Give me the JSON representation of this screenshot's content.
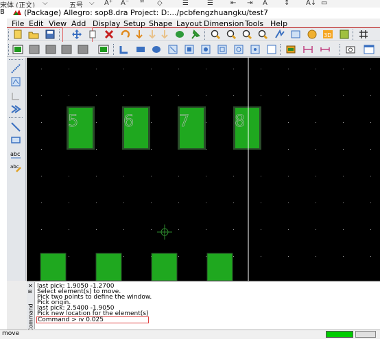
{
  "word_toolbar": {
    "font_name": "宋体 (正文)",
    "font_size": "五号",
    "left_letter": "B"
  },
  "window": {
    "title": "(Package) Allegro: sop8.dra  Project: D:.../pcbfengzhuangku/test7"
  },
  "menu": [
    {
      "label": "File"
    },
    {
      "label": "Edit"
    },
    {
      "label": "View"
    },
    {
      "label": "Add"
    },
    {
      "label": "Display"
    },
    {
      "label": "Setup"
    },
    {
      "label": "Shape"
    },
    {
      "label": "Layout"
    },
    {
      "label": "Dimension"
    },
    {
      "label": "Tools"
    },
    {
      "label": "Help"
    }
  ],
  "toolbar1_icons": [
    "new-icon",
    "open-icon",
    "save-icon",
    "move-icon",
    "copy-icon",
    "delete-icon",
    "undo-icon",
    "fix-icon",
    "unfix-icon",
    "add-connect-icon",
    "shape-icon",
    "pin-icon",
    "zoom-icon",
    "zoom-in-icon",
    "zoom-out-icon",
    "zoom-points-icon",
    "zoom-fit-icon",
    "zoom-prev-icon",
    "redraw-icon",
    "3d-view-icon",
    "grid-icon"
  ],
  "toolbar2_icons": [
    "layer-icon",
    "layer2-icon",
    "layer3-icon",
    "layer4-icon",
    "layer5-icon",
    "rect-icon",
    "roundrect-icon",
    "circle-icon",
    "pad-rect-icon",
    "pad-square-icon",
    "pad-round-icon",
    "pad-oval-icon",
    "pad-shape-icon",
    "pad-other-icon",
    "measure-icon",
    "dimension-icon",
    "dimension2-icon",
    "camera-icon",
    "window-icon"
  ],
  "left_icons": [
    "ruler-icon",
    "text-icon",
    "pin-edit-icon",
    "arrow-icon",
    "line-icon",
    "rect-tool-icon",
    "abc-icon",
    "abc-edit-icon"
  ],
  "canvas": {
    "pins_top": [
      "5",
      "6",
      "7",
      "8"
    ],
    "background": "#000000",
    "pad_color": "#1fa81f",
    "dot_color": "#9a9a9a"
  },
  "command": {
    "tab_label": "Command",
    "lines": [
      "last pick:  1.9050 -1.2700",
      "Select element(s) to move.",
      "Pick two points to define the window.",
      "Pick origin.",
      "last pick:  2.5400 -1.9050",
      "Pick new location for the element(s)"
    ],
    "prompt": "Command > iv 0.025"
  },
  "status": {
    "text": "move",
    "indicator_color": "#00cc00"
  }
}
